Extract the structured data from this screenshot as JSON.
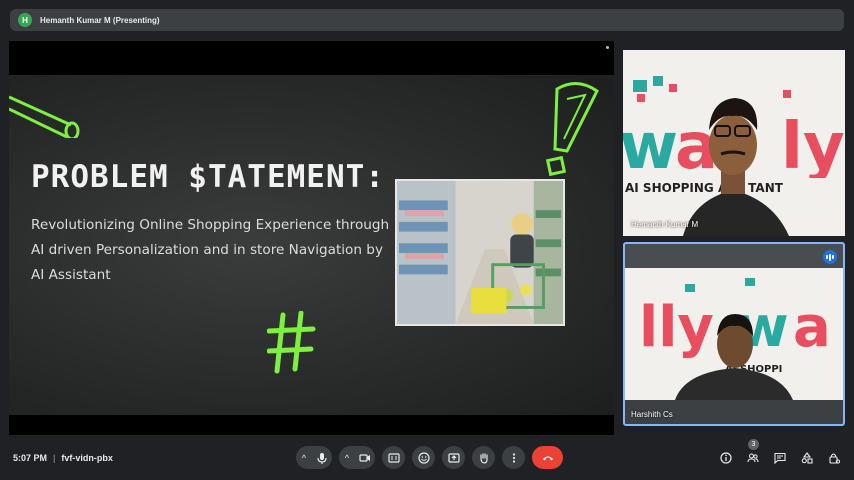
{
  "presenter": {
    "initial": "H",
    "label": "Hemanth Kumar M (Presenting)"
  },
  "slide": {
    "title": "PROBLEM $TATEMENT:",
    "body": "Revolutionizing Online Shopping Experience through AI driven Personalization and in store Navigation by AI Assistant"
  },
  "participants": [
    {
      "name": "Hemanth Kumar M",
      "speaking": false
    },
    {
      "name": "Harshith Cs",
      "speaking": true
    }
  ],
  "background_brand": {
    "logo": "Wally",
    "tagline": "AI SHOPPING ASSISTANT",
    "tagline_partial": "AI SHOPPI"
  },
  "meeting": {
    "time": "5:07 PM",
    "separator": "|",
    "code": "fvf-vidn-pbx"
  },
  "toolbar": {
    "icons": [
      "mic-icon",
      "camera-icon",
      "captions-icon",
      "emoji-icon",
      "present-icon",
      "raise-hand-icon",
      "more-icon",
      "end-call-icon"
    ],
    "right_icons": [
      "info-icon",
      "people-icon",
      "chat-icon",
      "activities-icon",
      "host-controls-icon"
    ],
    "participant_count": "3"
  },
  "colors": {
    "accent": "#8ab4f8",
    "end_call": "#ea4335",
    "doodle_green": "#7ef040",
    "speaking": "#1a73e8"
  }
}
